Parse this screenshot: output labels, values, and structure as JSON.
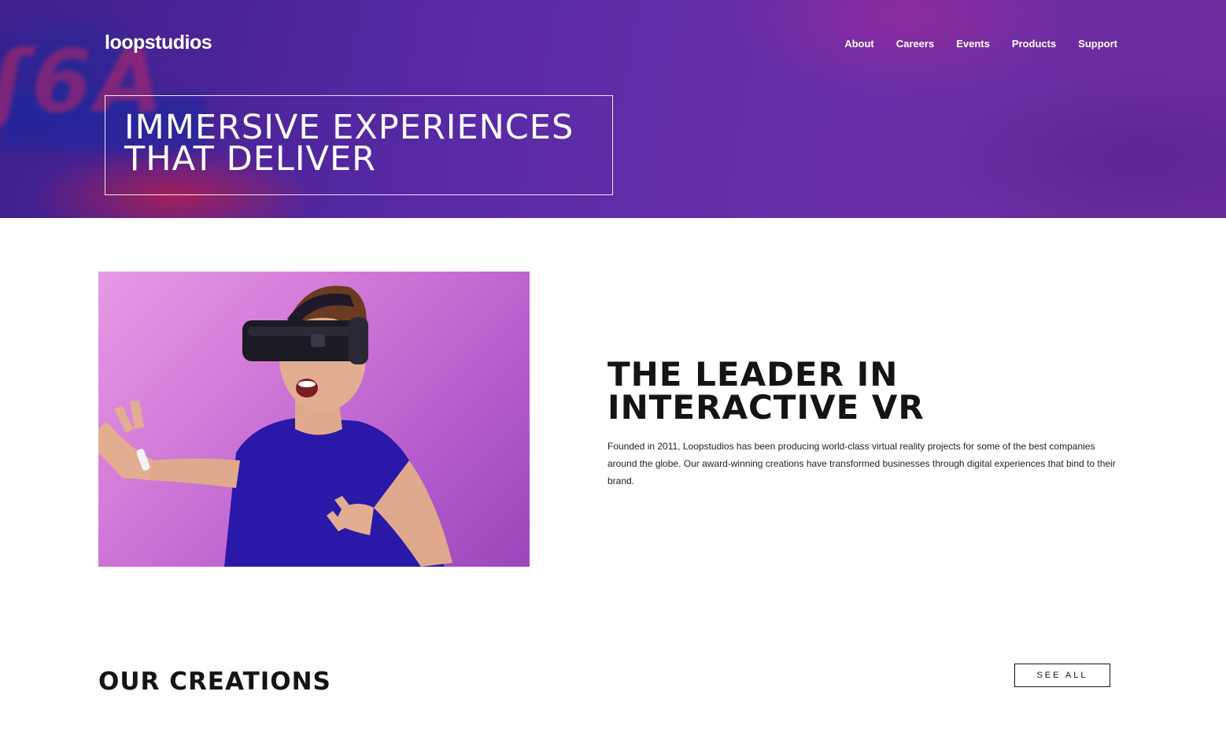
{
  "brand": {
    "logo": "loopstudios"
  },
  "nav": {
    "items": [
      {
        "label": "About"
      },
      {
        "label": "Careers"
      },
      {
        "label": "Events"
      },
      {
        "label": "Products"
      },
      {
        "label": "Support"
      }
    ]
  },
  "hero": {
    "headline_line1": "IMMERSIVE EXPERIENCES",
    "headline_line2": "THAT DELIVER"
  },
  "about": {
    "title_line1": "THE LEADER IN",
    "title_line2": "INTERACTIVE VR",
    "body": "Founded in 2011, Loopstudios has been producing world-class virtual reality projects for some of the best companies around the globe. Our award-winning creations have transformed businesses through digital experiences that bind to their brand."
  },
  "creations": {
    "title": "OUR CREATIONS",
    "see_all_label": "SEE ALL"
  },
  "colors": {
    "hero_purple": "#5a2aa6",
    "image_pink": "#d27ad8",
    "shirt_blue": "#2a18a8",
    "text_dark": "#141414"
  }
}
